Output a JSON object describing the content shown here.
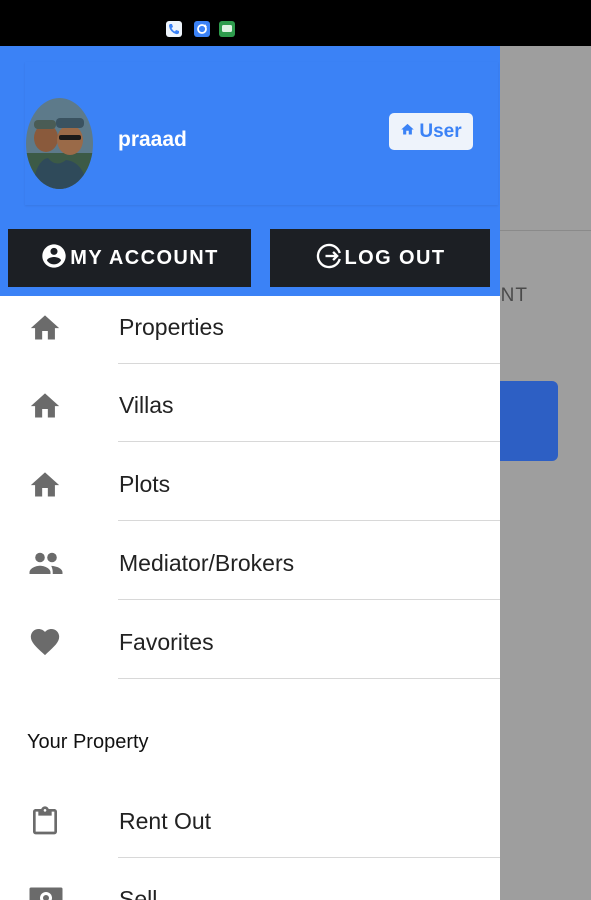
{
  "status_bar": {
    "icons": [
      "phone-icon",
      "sync-icon",
      "message-icon"
    ]
  },
  "background_screen": {
    "tab_text_partial": "ENT"
  },
  "drawer": {
    "header": {
      "user_name": "praaad",
      "role_badge": {
        "icon": "home-icon",
        "label": "User"
      },
      "buttons": {
        "my_account": {
          "icon": "account-circle-icon",
          "label": "MY ACCOUNT"
        },
        "log_out": {
          "icon": "logout-icon",
          "label": "LOG OUT"
        }
      }
    },
    "menu": [
      {
        "label": "Properties",
        "icon": "home-icon"
      },
      {
        "label": "Villas",
        "icon": "home-icon"
      },
      {
        "label": "Plots",
        "icon": "home-icon"
      },
      {
        "label": "Mediator/Brokers",
        "icon": "people-icon"
      },
      {
        "label": "Favorites",
        "icon": "heart-icon"
      }
    ],
    "section_title": "Your Property",
    "property_menu": [
      {
        "label": "Rent Out",
        "icon": "clipboard-icon"
      },
      {
        "label": "Sell",
        "icon": "money-icon"
      }
    ]
  },
  "colors": {
    "primary": "#3b82f6",
    "header_button_bg": "#1c1f24",
    "icon_gray": "#6b6b6b",
    "scrim_gray": "#9e9e9e"
  }
}
